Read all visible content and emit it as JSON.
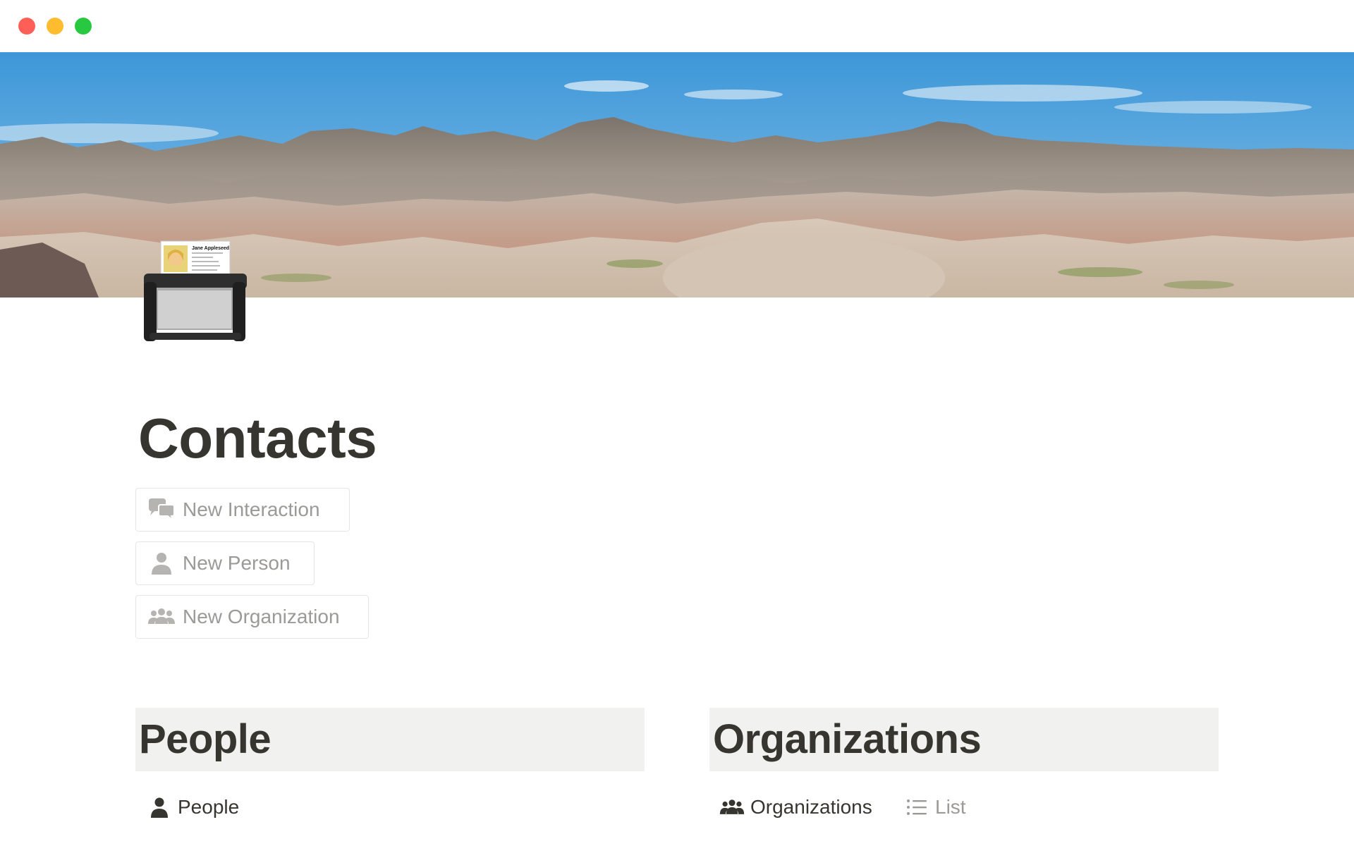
{
  "window": {
    "controls": {
      "close_color": "#ff5f57",
      "minimize_color": "#febc2e",
      "maximize_color": "#28c840"
    }
  },
  "cover": {
    "description_icon": "badlands-landscape-image",
    "sky_color": "#4a9fdc"
  },
  "page_icon": {
    "icon": "rolodex-card-file-icon",
    "card_name": "Jane Appleseed"
  },
  "page": {
    "title": "Contacts"
  },
  "actions": [
    {
      "label": "New Interaction",
      "icon": "speech-bubbles-icon"
    },
    {
      "label": "New Person",
      "icon": "person-icon"
    },
    {
      "label": "New Organization",
      "icon": "group-icon"
    }
  ],
  "sections": {
    "people": {
      "heading": "People",
      "tabs": [
        {
          "label": "People",
          "icon": "person-icon",
          "active": true
        }
      ]
    },
    "organizations": {
      "heading": "Organizations",
      "tabs": [
        {
          "label": "Organizations",
          "icon": "group-icon",
          "active": true
        },
        {
          "label": "List",
          "icon": "list-icon",
          "active": false
        }
      ]
    }
  },
  "colors": {
    "text_primary": "#37352f",
    "text_muted": "#9b9a97",
    "section_bg": "#f1f1ef",
    "button_border": "#e5e5e3"
  }
}
